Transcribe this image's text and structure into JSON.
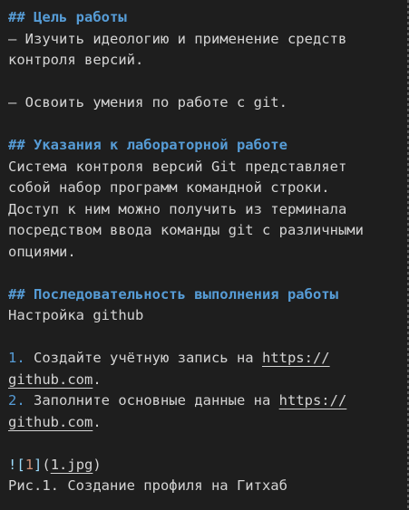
{
  "colors": {
    "background": "#1e1e1e",
    "text": "#d4d4d4",
    "heading": "#569cd6"
  },
  "lines": [
    {
      "type": "heading",
      "text": "## Цель работы"
    },
    {
      "type": "text",
      "text": "— Изучить идеологию и применение средств"
    },
    {
      "type": "text",
      "text": "контроля версий."
    },
    {
      "type": "blank",
      "text": ""
    },
    {
      "type": "text",
      "text": "— Освоить умения по работе с git."
    },
    {
      "type": "blank",
      "text": ""
    },
    {
      "type": "heading",
      "text": "## Указания к лабораторной работе"
    },
    {
      "type": "text",
      "text": "Система контроля версий Git представляет"
    },
    {
      "type": "text",
      "text": "собой набор программ командной строки."
    },
    {
      "type": "text",
      "text": "Доступ к ним можно получить из терминала"
    },
    {
      "type": "text",
      "text": "посредством ввода команды git с различными"
    },
    {
      "type": "text",
      "text": "опциями."
    },
    {
      "type": "blank",
      "text": ""
    },
    {
      "type": "heading",
      "text": "## Последовательность выполнения работы"
    },
    {
      "type": "text",
      "text": "Настройка github"
    },
    {
      "type": "blank",
      "text": ""
    },
    {
      "type": "list",
      "num": "1.",
      "text": " Создайте учётную запись на ",
      "link": "https://"
    },
    {
      "type": "linkcont",
      "text": "github.com",
      "tail": "."
    },
    {
      "type": "list",
      "num": "2.",
      "text": " Заполните основные данные на ",
      "link": "https://"
    },
    {
      "type": "linkcont",
      "text": "github.com",
      "tail": "."
    },
    {
      "type": "blank",
      "text": ""
    },
    {
      "type": "image",
      "bang": "!",
      "ob": "[",
      "alt": "1",
      "cb": "]",
      "op": "(",
      "url": "1.jpg",
      "cp": ")"
    },
    {
      "type": "text",
      "text": "Рис.1. Создание профиля на Гитхаб"
    }
  ]
}
